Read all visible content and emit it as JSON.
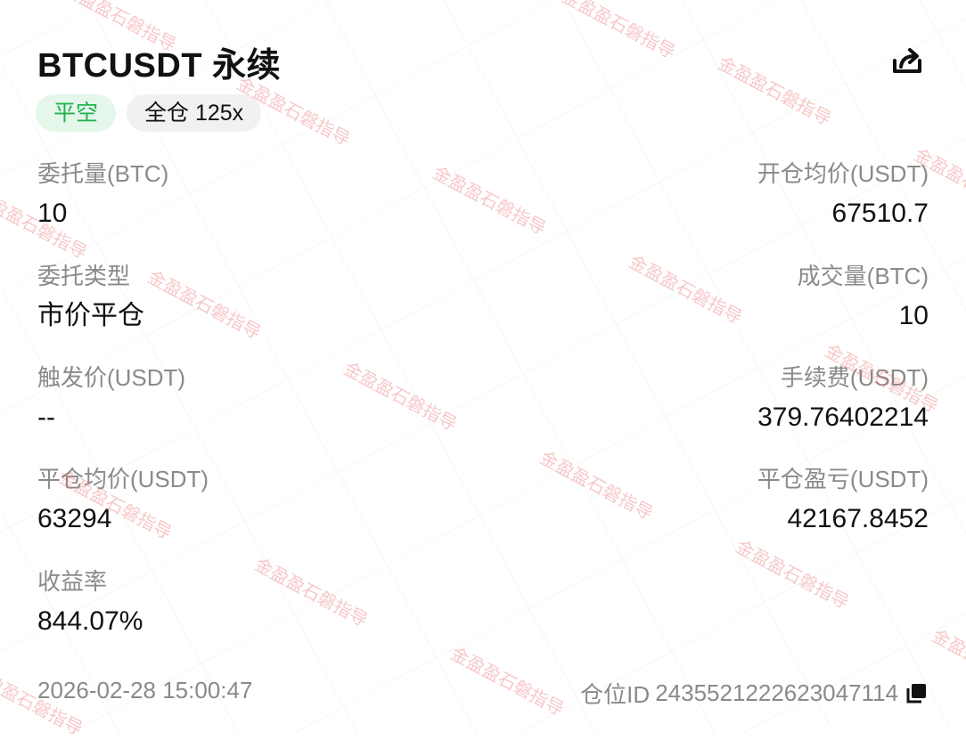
{
  "header": {
    "title": "BTCUSDT 永续",
    "share_icon": "share-icon"
  },
  "badges": {
    "side": "平空",
    "margin": "全仓 125x"
  },
  "colors": {
    "side_badge_bg": "#e5f6ea",
    "side_badge_text": "#20b24f",
    "label": "#8a8a8a",
    "value": "#111111",
    "watermark": "#eb6e6e"
  },
  "fields": {
    "order_qty": {
      "label": "委托量(BTC)",
      "value": "10"
    },
    "open_avg_price": {
      "label": "开仓均价(USDT)",
      "value": "67510.7"
    },
    "order_type": {
      "label": "委托类型",
      "value": "市价平仓"
    },
    "filled_qty": {
      "label": "成交量(BTC)",
      "value": "10"
    },
    "trigger_price": {
      "label": "触发价(USDT)",
      "value": "--"
    },
    "fee": {
      "label": "手续费(USDT)",
      "value": "379.76402214"
    },
    "close_avg_price": {
      "label": "平仓均价(USDT)",
      "value": "63294"
    },
    "close_pnl": {
      "label": "平仓盈亏(USDT)",
      "value": "42167.8452"
    },
    "roi": {
      "label": "收益率",
      "value": "844.07%"
    }
  },
  "footer": {
    "time": "2026-02-28 15:00:47",
    "position_id_label": "仓位ID",
    "position_id": "2435521222623047114",
    "copy_icon": "copy-icon"
  },
  "watermark": {
    "text": "金盈盈石磐指导"
  }
}
